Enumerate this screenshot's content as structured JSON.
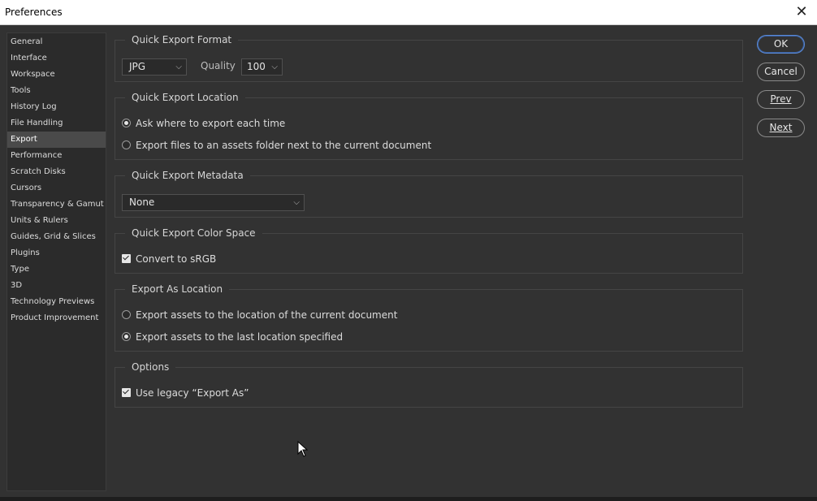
{
  "window": {
    "title": "Preferences",
    "close_icon": "close-icon"
  },
  "sidebar": {
    "items": [
      {
        "label": "General"
      },
      {
        "label": "Interface"
      },
      {
        "label": "Workspace"
      },
      {
        "label": "Tools"
      },
      {
        "label": "History Log"
      },
      {
        "label": "File Handling"
      },
      {
        "label": "Export",
        "active": true
      },
      {
        "label": "Performance"
      },
      {
        "label": "Scratch Disks"
      },
      {
        "label": "Cursors"
      },
      {
        "label": "Transparency & Gamut"
      },
      {
        "label": "Units & Rulers"
      },
      {
        "label": "Guides, Grid & Slices"
      },
      {
        "label": "Plugins"
      },
      {
        "label": "Type"
      },
      {
        "label": "3D"
      },
      {
        "label": "Technology Previews"
      },
      {
        "label": "Product Improvement"
      }
    ]
  },
  "quick_export_format": {
    "title": "Quick Export Format",
    "format_value": "JPG",
    "quality_label": "Quality",
    "quality_value": "100"
  },
  "quick_export_location": {
    "title": "Quick Export Location",
    "options": [
      {
        "label": "Ask where to export each time",
        "selected": true
      },
      {
        "label": "Export files to an assets folder next to the current document",
        "selected": false
      }
    ]
  },
  "quick_export_metadata": {
    "title": "Quick Export Metadata",
    "value": "None"
  },
  "quick_export_color_space": {
    "title": "Quick Export Color Space",
    "convert_label": "Convert to sRGB",
    "convert_checked": true
  },
  "export_as_location": {
    "title": "Export As Location",
    "options": [
      {
        "label": "Export assets to the location of the current document",
        "selected": false
      },
      {
        "label": "Export assets to the last location specified",
        "selected": true
      }
    ]
  },
  "options": {
    "title": "Options",
    "legacy_label": "Use legacy “Export As”",
    "legacy_checked": true
  },
  "buttons": {
    "ok": "OK",
    "cancel": "Cancel",
    "prev": "Prev",
    "next": "Next"
  },
  "colors": {
    "background": "#323232",
    "sidebar_bg": "#2b2b2b",
    "active_item": "#4a4a4a",
    "ok_border": "#5b8ad6"
  }
}
